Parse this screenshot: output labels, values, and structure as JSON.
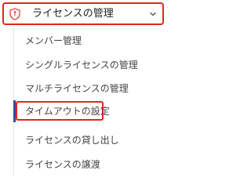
{
  "nav": {
    "section": {
      "label": "ライセンスの管理",
      "icon": "shield-icon",
      "expand_icon": "chevron-down-icon"
    },
    "items": [
      {
        "label": "メンバー管理"
      },
      {
        "label": "シングルライセンスの管理"
      },
      {
        "label": "マルチライセンスの管理"
      },
      {
        "label": "タイムアウトの設定",
        "active": true
      },
      {
        "label": "ライセンスの貸し出し"
      },
      {
        "label": "ライセンスの譲渡"
      }
    ]
  },
  "colors": {
    "highlight_border": "#e0261c",
    "active_rail": "#3a4a9a",
    "icon": "#d9534f"
  }
}
